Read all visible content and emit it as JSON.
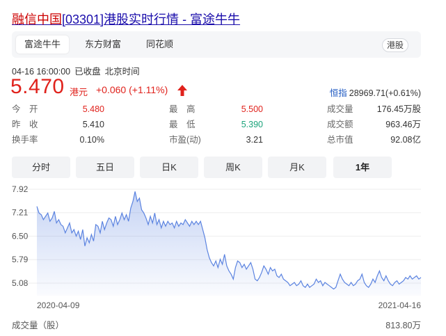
{
  "title": {
    "prefix": "融信中国",
    "code": "[03301]",
    "suffix": "港股实时行情 - 富途牛牛"
  },
  "source_tabs": [
    "富途牛牛",
    "东方财富",
    "同花顺"
  ],
  "market_tag": "港股",
  "datetime": {
    "date": "04-16 16:00:00",
    "status": "已收盘",
    "timezone": "北京时间"
  },
  "quote": {
    "price": "5.470",
    "currency": "港元",
    "change": "+0.060 (+1.11%)"
  },
  "index": {
    "label": "恒指",
    "value": "28969.71(+0.61%)"
  },
  "stats": {
    "open_label": "今　开",
    "open": "5.480",
    "prev_label": "昨　收",
    "prev": "5.410",
    "turnover_rate_label": "换手率",
    "turnover_rate": "0.10%",
    "high_label": "最　高",
    "high": "5.500",
    "low_label": "最　低",
    "low": "5.390",
    "pe_label": "市盈(动)",
    "pe": "3.21",
    "volume_label": "成交量",
    "volume": "176.45万股",
    "amount_label": "成交额",
    "amount": "963.46万",
    "mcap_label": "总市值",
    "mcap": "92.08亿"
  },
  "period_tabs": [
    "分时",
    "五日",
    "日K",
    "周K",
    "月K",
    "1年"
  ],
  "active_period": "1年",
  "colors": {
    "up": "#e0221c",
    "down": "#1aa37a",
    "line": "#5b83e0",
    "link": "#1a0dab"
  },
  "chart_data": {
    "type": "area",
    "y_ticks": [
      "7.92",
      "7.21",
      "6.50",
      "5.79",
      "5.08"
    ],
    "ylim": [
      4.7,
      7.92
    ],
    "x_labels": [
      "2020-04-09",
      "2021-04-16"
    ],
    "x": [
      "2020-04-09",
      "2021-04-16"
    ],
    "values": [
      7.4,
      7.2,
      7.15,
      7.0,
      7.1,
      7.2,
      6.95,
      7.05,
      7.25,
      6.9,
      7.0,
      6.85,
      6.8,
      6.6,
      6.75,
      6.9,
      6.6,
      6.7,
      6.5,
      6.65,
      6.4,
      6.7,
      6.2,
      6.45,
      6.3,
      6.55,
      6.35,
      6.85,
      6.8,
      6.6,
      6.95,
      6.7,
      6.9,
      7.05,
      7.0,
      6.8,
      7.1,
      6.85,
      7.0,
      7.2,
      7.0,
      7.15,
      6.95,
      7.35,
      7.55,
      7.85,
      7.55,
      7.65,
      7.3,
      7.2,
      7.05,
      6.85,
      7.1,
      6.9,
      7.2,
      6.85,
      7.0,
      6.75,
      6.95,
      6.8,
      6.95,
      6.85,
      6.9,
      6.75,
      6.95,
      6.8,
      6.9,
      6.85,
      7.0,
      6.9,
      6.8,
      6.95,
      6.85,
      6.95,
      6.85,
      6.95,
      6.7,
      6.45,
      6.1,
      5.85,
      5.7,
      5.6,
      5.75,
      5.55,
      5.8,
      5.65,
      5.95,
      5.6,
      5.45,
      5.35,
      5.2,
      5.55,
      5.75,
      5.7,
      5.55,
      5.65,
      5.5,
      5.6,
      5.7,
      5.5,
      5.2,
      5.15,
      5.25,
      5.4,
      5.6,
      5.5,
      5.35,
      5.55,
      5.45,
      5.5,
      5.3,
      5.25,
      5.35,
      5.2,
      5.15,
      5.1,
      5.0,
      5.05,
      5.1,
      5.0,
      5.05,
      5.15,
      5.0,
      4.95,
      5.05,
      4.95,
      5.0,
      5.05,
      5.2,
      5.1,
      5.15,
      5.0,
      5.1,
      5.05,
      5.0,
      4.95,
      4.9,
      4.95,
      5.15,
      5.35,
      5.2,
      5.1,
      5.05,
      5.0,
      5.1,
      5.0,
      5.05,
      5.15,
      5.2,
      5.35,
      5.1,
      5.0,
      4.95,
      5.05,
      5.2,
      5.1,
      5.3,
      5.45,
      5.25,
      5.15,
      5.3,
      5.15,
      5.05,
      5.0,
      5.1,
      5.15,
      5.05,
      5.1,
      5.15,
      5.25,
      5.2,
      5.3,
      5.2,
      5.25,
      5.3,
      5.2,
      5.25
    ]
  },
  "volume": {
    "label": "成交量（股）",
    "value": "813.80万"
  }
}
